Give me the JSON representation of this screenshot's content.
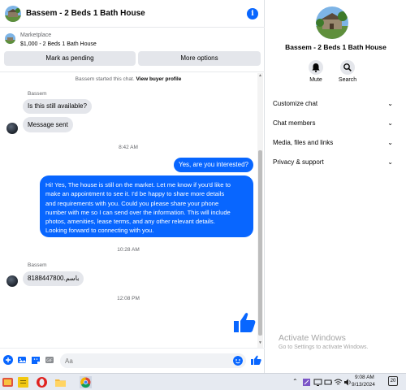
{
  "header": {
    "title": "Bassem - 2 Beds 1 Bath House",
    "info_icon": "info-icon"
  },
  "marketplace": {
    "label": "Marketplace",
    "item": "$1,000 - 2 Beds 1 Bath House",
    "mark_pending_label": "Mark as pending",
    "more_options_label": "More options"
  },
  "thread": {
    "started_text": "Bassem started this chat.",
    "view_profile_link": "View buyer profile",
    "sender_name": "Bassem",
    "msg1": "Is this still available?",
    "msg2": "Message sent",
    "time1": "8:42 AM",
    "reply1": "Yes, are you interested?",
    "reply2_lines": [
      "Hi! Yes, The house is still on the market. Let me know if you'd like to",
      "make an appointment to see it. I'd be happy to share more details",
      "and requirements with you. Could you please share your phone",
      "number with me so I can send over the information. This will include",
      "photos, amenities, lease terms, and any other relevant details.",
      "Looking forward to connecting with you."
    ],
    "time2": "10:28 AM",
    "sender_name2": "Bassem",
    "msg3": "8188447800.باسم",
    "time3": "12:08 PM",
    "like_icon": "thumbs-up-icon"
  },
  "composer": {
    "placeholder": "Aa"
  },
  "side": {
    "title": "Bassem - 2 Beds 1 Bath House",
    "mute_label": "Mute",
    "search_label": "Search",
    "menu": [
      "Customize chat",
      "Chat members",
      "Media, files and links",
      "Privacy & support"
    ]
  },
  "watermark": {
    "line1": "Activate Windows",
    "line2": "Go to Settings to activate Windows."
  },
  "taskbar": {
    "time": "9:08 AM",
    "date": "9/13/2024",
    "notifications": "20"
  },
  "colors": {
    "accent": "#0866ff",
    "bubble_in": "#e4e6eb",
    "text": "#050505",
    "muted": "#65676b"
  }
}
